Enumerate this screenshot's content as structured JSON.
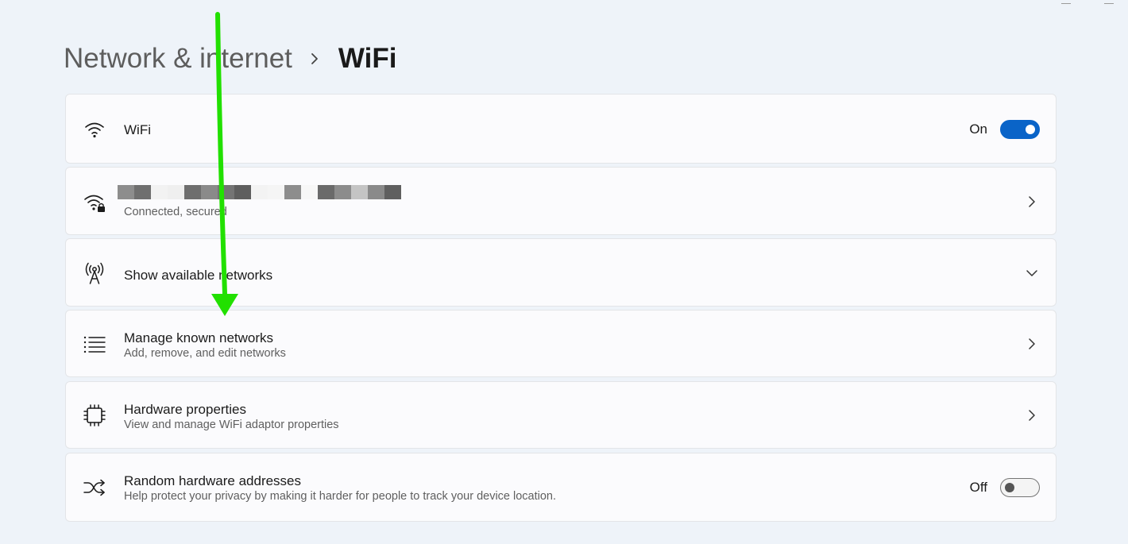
{
  "breadcrumb": {
    "parent": "Network & internet",
    "current": "WiFi"
  },
  "rows": {
    "wifi": {
      "icon": "wifi-icon",
      "title": "WiFi",
      "toggle_label": "On",
      "toggle_state": true
    },
    "connected_network": {
      "icon": "wifi-lock-icon",
      "title": "",
      "subtitle": "Connected, secured"
    },
    "available": {
      "icon": "antenna-icon",
      "title": "Show available networks"
    },
    "manage": {
      "icon": "list-icon",
      "title": "Manage known networks",
      "subtitle": "Add, remove, and edit networks"
    },
    "hardware": {
      "icon": "chip-icon",
      "title": "Hardware properties",
      "subtitle": "View and manage WiFi adaptor properties"
    },
    "random": {
      "icon": "shuffle-icon",
      "title": "Random hardware addresses",
      "subtitle": "Help protect your privacy by making it harder for people to track your device location.",
      "toggle_label": "Off",
      "toggle_state": false
    }
  },
  "colors": {
    "accent": "#0a64c8",
    "annotation_arrow": "#22e000",
    "background": "#eef3f9",
    "card": "#fbfbfd"
  }
}
